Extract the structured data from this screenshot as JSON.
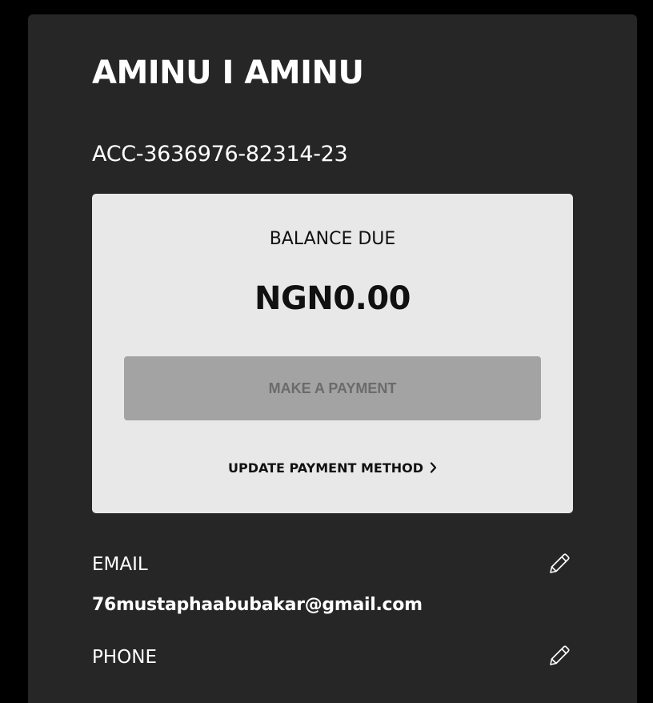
{
  "account_holder": {
    "name": "AMINU I AMINU",
    "account_number": "ACC-3636976-82314-23"
  },
  "balance": {
    "label": "BALANCE DUE",
    "amount": "NGN0.00",
    "pay_button_label": "MAKE A PAYMENT",
    "update_link_label": "UPDATE PAYMENT METHOD",
    "update_link_icon": "chevron-right-icon"
  },
  "email": {
    "label": "EMAIL",
    "value": "76mustaphaabubakar@gmail.com",
    "edit_icon": "pencil-icon"
  },
  "phone": {
    "label": "PHONE",
    "edit_icon": "pencil-icon"
  },
  "colors": {
    "page_background": "#000000",
    "panel_background": "#262626",
    "card_background": "#e8e8e8",
    "button_disabled_background": "#a3a3a3",
    "button_disabled_text": "#6b6b6b",
    "text_light": "#ffffff",
    "text_dark": "#111111"
  }
}
